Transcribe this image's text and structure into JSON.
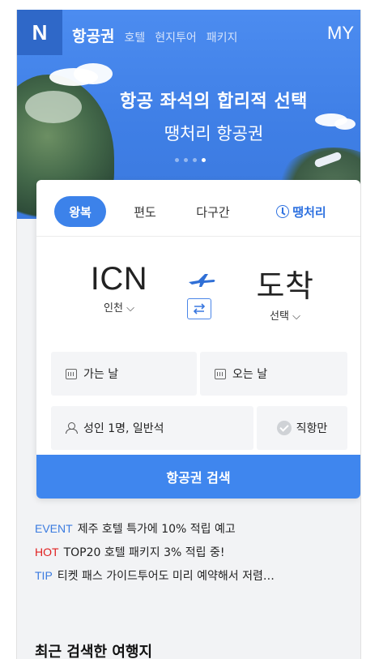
{
  "header": {
    "logo": "N",
    "nav": [
      {
        "label": "항공권",
        "active": true
      },
      {
        "label": "호텔",
        "active": false
      },
      {
        "label": "현지투어",
        "active": false
      },
      {
        "label": "패키지",
        "active": false
      }
    ],
    "my_label": "MY"
  },
  "hero": {
    "title": "항공 좌석의 합리적 선택",
    "subtitle": "땡처리 항공권",
    "slides_total": 4,
    "slide_active": 4
  },
  "search": {
    "tabs": [
      {
        "label": "왕복",
        "active": true
      },
      {
        "label": "편도",
        "active": false
      },
      {
        "label": "다구간",
        "active": false
      },
      {
        "label": "땡처리",
        "active": false,
        "icon": "clock-icon"
      }
    ],
    "origin": {
      "code": "ICN",
      "city": "인천"
    },
    "destination": {
      "code": "도착",
      "city": "선택"
    },
    "depart_label": "가는 날",
    "return_label": "오는 날",
    "passengers_label": "성인 1명, 일반석",
    "direct_label": "직항만",
    "submit_label": "항공권 검색"
  },
  "notices": [
    {
      "tag": "EVENT",
      "text": "제주 호텔 특가에 10% 적립 예고"
    },
    {
      "tag": "HOT",
      "text": "TOP20 호텔 패키지 3% 적립 중!"
    },
    {
      "tag": "TIP",
      "text": "티켓 패스 가이드투어도 미리 예약해서 저렴…"
    }
  ],
  "recent": {
    "title": "최근 검색한 여행지"
  },
  "colors": {
    "accent": "#3f86ee",
    "hot": "#e02020"
  }
}
